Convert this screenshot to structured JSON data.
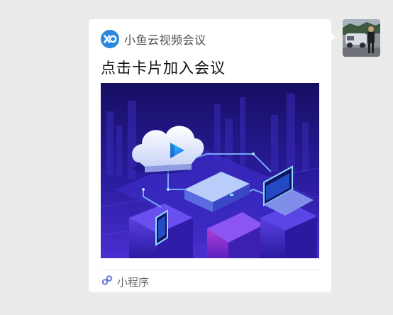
{
  "message": {
    "app_name": "小鱼云视频会议",
    "title": "点击卡片加入会议",
    "footer_label": "小程序"
  },
  "colors": {
    "app_logo": "#2c88dd",
    "banner_background": "#2a1c9e",
    "chat_background": "#ebebeb"
  },
  "icons": {
    "app_logo": "xiaoyu-logo-icon",
    "mini_program": "mini-program-icon",
    "avatar": "user-avatar"
  }
}
